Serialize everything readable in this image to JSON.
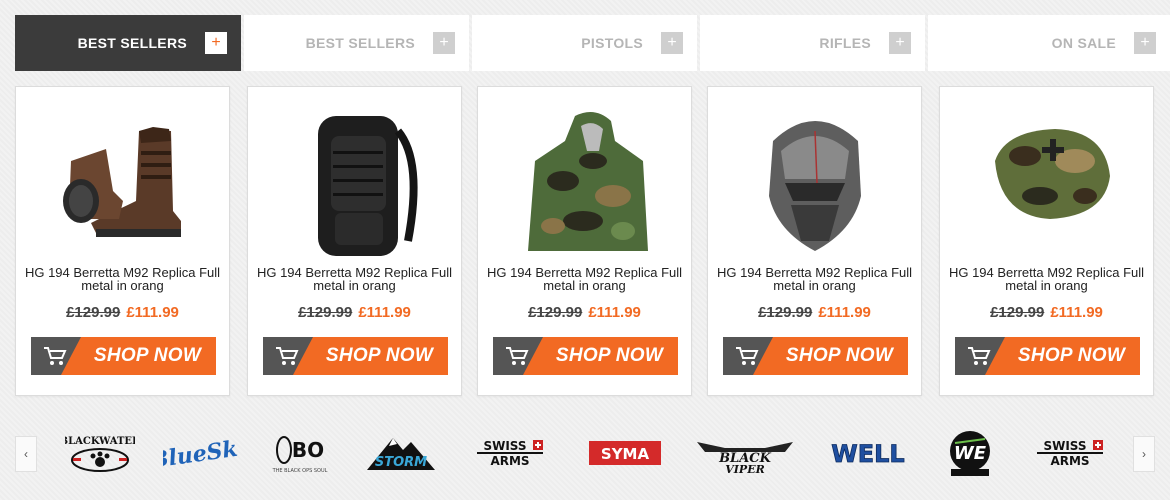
{
  "tabs": [
    {
      "label": "BEST SELLERS",
      "plus": "+"
    },
    {
      "label": "BEST SELLERS",
      "plus": "+"
    },
    {
      "label": "PISTOLS",
      "plus": "+"
    },
    {
      "label": "RIFLES",
      "plus": "+"
    },
    {
      "label": "ON SALE",
      "plus": "+"
    }
  ],
  "products": [
    {
      "name": "HG 194 Berretta M92 Replica Full metal in orang",
      "old_price": "£129.99",
      "new_price": "£111.99",
      "image": "boots",
      "cta": "SHOP NOW"
    },
    {
      "name": "HG 194 Berretta M92 Replica Full metal in orang",
      "old_price": "£129.99",
      "new_price": "£111.99",
      "image": "backpack",
      "cta": "SHOP NOW"
    },
    {
      "name": "HG 194 Berretta M92 Replica Full metal in orang",
      "old_price": "£129.99",
      "new_price": "£111.99",
      "image": "camo-jacket",
      "cta": "SHOP NOW"
    },
    {
      "name": "HG 194 Berretta M92 Replica Full metal in orang",
      "old_price": "£129.99",
      "new_price": "£111.99",
      "image": "predator-mask",
      "cta": "SHOP NOW"
    },
    {
      "name": "HG 194 Berretta M92 Replica Full metal in orang",
      "old_price": "£129.99",
      "new_price": "£111.99",
      "image": "camo-pouch",
      "cta": "SHOP NOW"
    }
  ],
  "brands": [
    "BLACKWATER",
    "BlueSky",
    "BO",
    "STORM",
    "SWISS ARMS",
    "SYMA",
    "BLACK VIPER",
    "WELL",
    "WE",
    "SWISS ARMS"
  ],
  "brand_arrows": {
    "prev": "‹",
    "next": "›"
  },
  "colors": {
    "accent": "#f26a23",
    "dark": "#3b3b3b"
  }
}
